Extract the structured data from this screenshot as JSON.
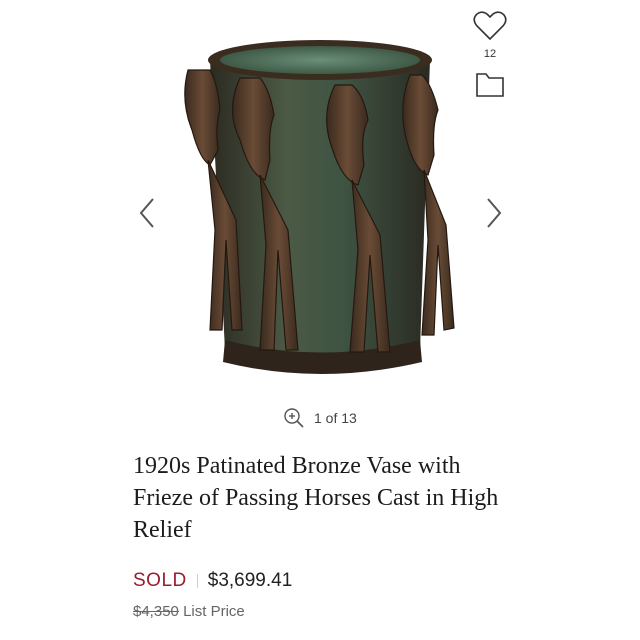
{
  "gallery": {
    "image_alt": "Bronze vase with relief of horses",
    "counter_text": "1 of 13",
    "icons": {
      "prev": "chevron-left-icon",
      "next": "chevron-right-icon",
      "zoom": "zoom-in-icon",
      "favorite": "heart-icon",
      "folder": "folder-icon"
    },
    "favorites_count": "12"
  },
  "product": {
    "title": "1920s Patinated Bronze Vase with Frieze of Passing Horses Cast in High Relief",
    "status": "SOLD",
    "price": "$3,699.41",
    "list_price": "$4,350",
    "list_price_label": "List Price"
  },
  "colors": {
    "sold": "#9b1c2e",
    "bronze": "#4a3628",
    "patina": "#3e5a47"
  }
}
